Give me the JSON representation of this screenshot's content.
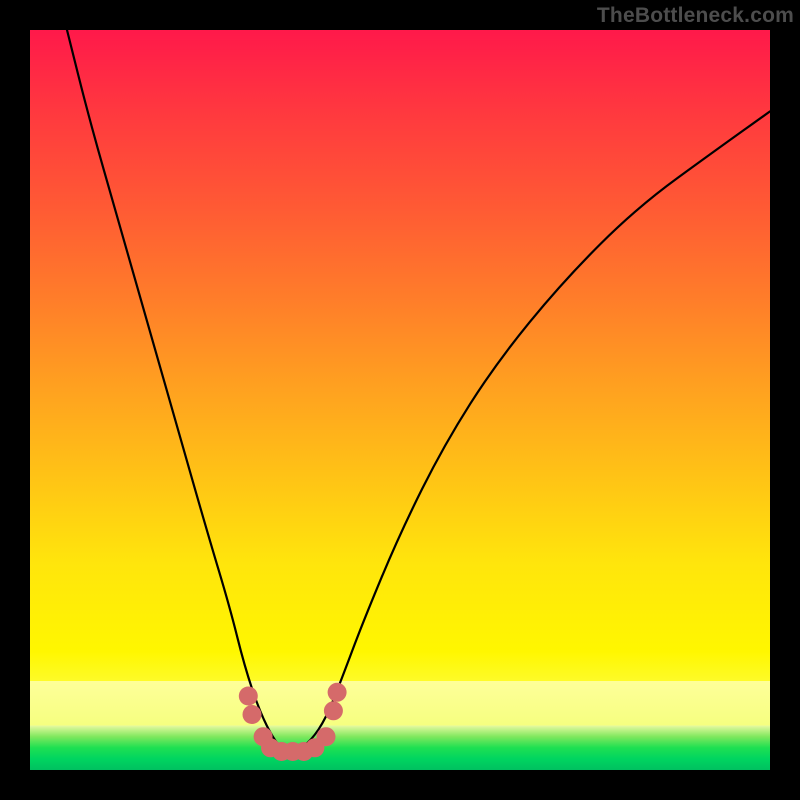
{
  "watermark": "TheBottleneck.com",
  "chart_data": {
    "type": "line",
    "title": "",
    "xlabel": "",
    "ylabel": "",
    "xlim": [
      0,
      100
    ],
    "ylim": [
      0,
      100
    ],
    "grid": false,
    "legend": false,
    "series": [
      {
        "name": "bottleneck-curve",
        "x": [
          5,
          8,
          12,
          16,
          20,
          24,
          27,
          29,
          31,
          33,
          34.5,
          36,
          38,
          40,
          42,
          45,
          50,
          56,
          63,
          72,
          82,
          93,
          100
        ],
        "y": [
          100,
          88,
          74,
          60,
          46,
          32,
          22,
          14,
          8,
          4,
          2.5,
          2.5,
          4,
          7,
          12,
          20,
          32,
          44,
          55,
          66,
          76,
          84,
          89
        ]
      }
    ],
    "markers": {
      "name": "bottom-cluster",
      "color": "#d56a6a",
      "points": [
        {
          "x": 29.5,
          "y": 10
        },
        {
          "x": 30.0,
          "y": 7.5
        },
        {
          "x": 31.5,
          "y": 4.5
        },
        {
          "x": 32.5,
          "y": 3.0
        },
        {
          "x": 34.0,
          "y": 2.5
        },
        {
          "x": 35.5,
          "y": 2.5
        },
        {
          "x": 37.0,
          "y": 2.5
        },
        {
          "x": 38.5,
          "y": 3.0
        },
        {
          "x": 40.0,
          "y": 4.5
        },
        {
          "x": 41.0,
          "y": 8.0
        },
        {
          "x": 41.5,
          "y": 10.5
        }
      ]
    },
    "gradient_bands": [
      {
        "name": "red-magenta",
        "from_y": 100,
        "to_y": 85,
        "color": "#ff194a"
      },
      {
        "name": "red-orange",
        "from_y": 85,
        "to_y": 60,
        "color": "#ff6a2e"
      },
      {
        "name": "orange",
        "from_y": 60,
        "to_y": 40,
        "color": "#ffae18"
      },
      {
        "name": "yellow",
        "from_y": 40,
        "to_y": 15,
        "color": "#ffee00"
      },
      {
        "name": "pale-yellow",
        "from_y": 15,
        "to_y": 6,
        "color": "#f9ff8a"
      },
      {
        "name": "green",
        "from_y": 6,
        "to_y": 0,
        "color": "#1ee052"
      }
    ]
  }
}
